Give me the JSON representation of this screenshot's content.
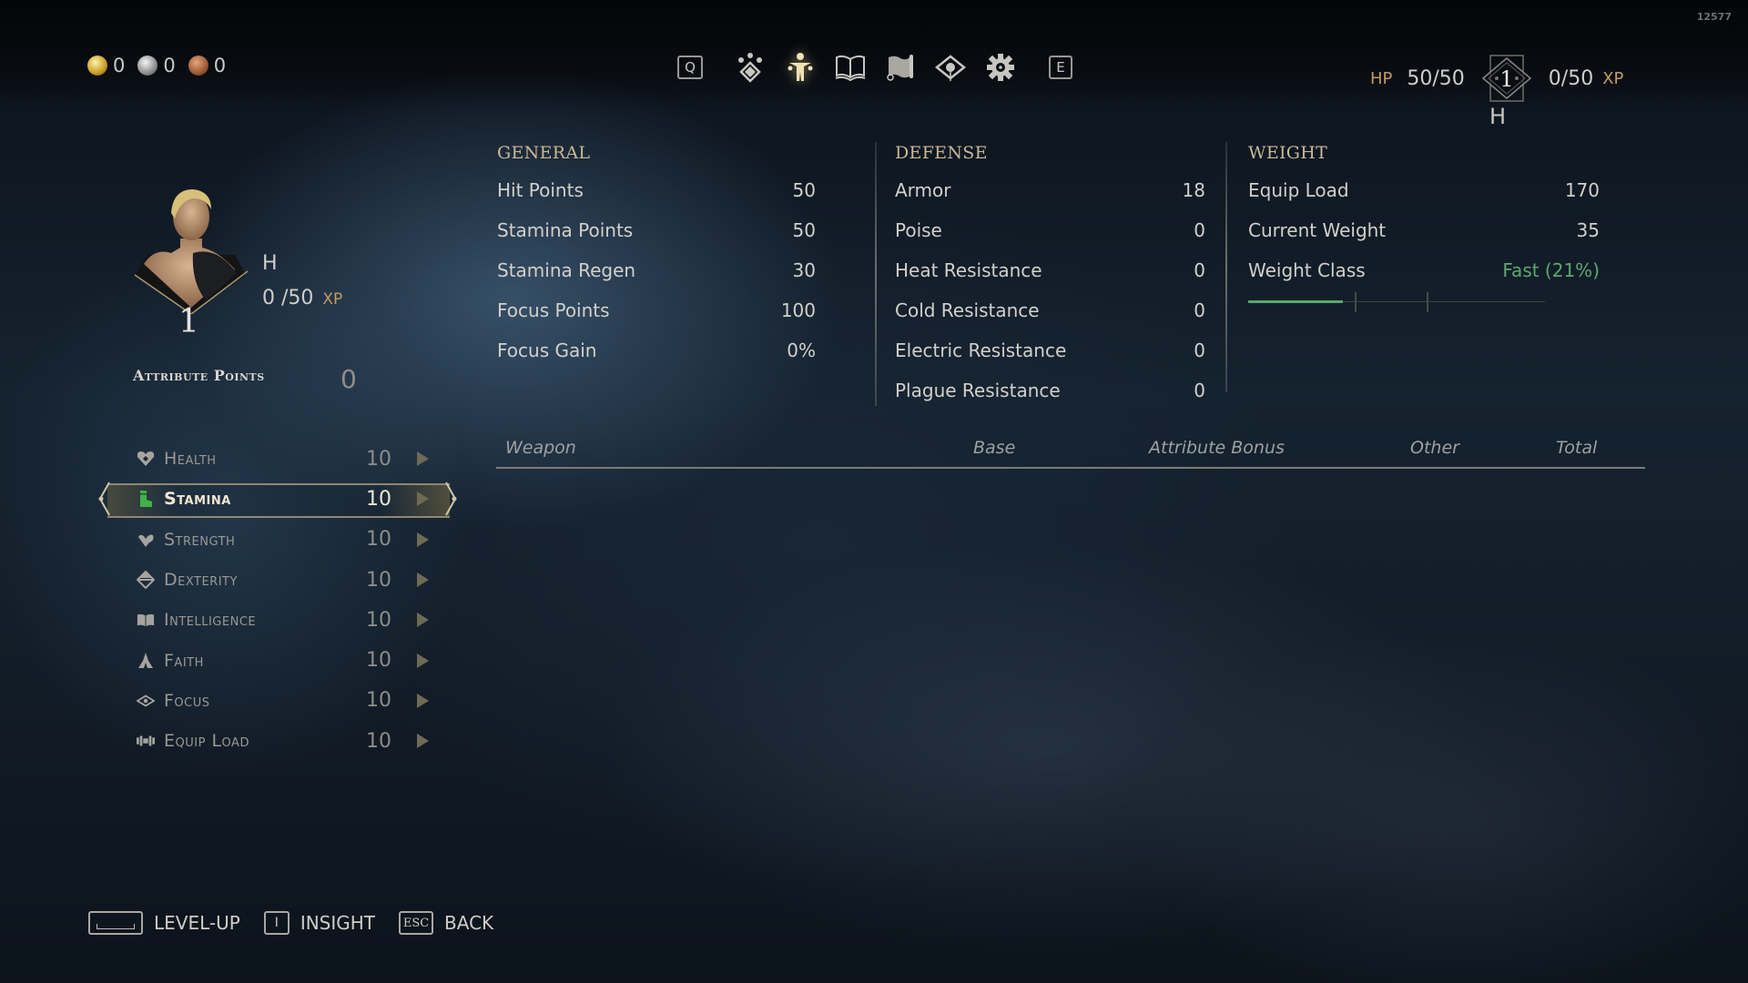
{
  "build_number": "12577",
  "currency": [
    {
      "type": "gold",
      "icon": "gold-coin-icon",
      "amount": "0"
    },
    {
      "type": "silver",
      "icon": "silver-coin-icon",
      "amount": "0"
    },
    {
      "type": "copper",
      "icon": "copper-coin-icon",
      "amount": "0"
    }
  ],
  "top_menu": {
    "prev_key": "Q",
    "next_key": "E",
    "tabs": [
      {
        "icon": "skills-icon",
        "active": false
      },
      {
        "icon": "character-icon",
        "active": true
      },
      {
        "icon": "journal-book-icon",
        "active": false
      },
      {
        "icon": "map-scroll-icon",
        "active": false
      },
      {
        "icon": "eye-insight-icon",
        "active": false
      },
      {
        "icon": "settings-gear-icon",
        "active": false
      }
    ]
  },
  "hud": {
    "hp_label": "HP",
    "hp_value": "50/50",
    "level": "1",
    "xp_value": "0/50",
    "xp_label": "XP",
    "character_initial": "H"
  },
  "character": {
    "name": "H",
    "level": "1",
    "xp_current": "0",
    "xp_max": "50",
    "xp_text": "0 /50",
    "xp_label": "XP",
    "attribute_points_label": "Attribute Points",
    "attribute_points": "0"
  },
  "attributes": [
    {
      "name": "Health",
      "value": "10",
      "icon": "heart-icon",
      "selected": false
    },
    {
      "name": "Stamina",
      "value": "10",
      "icon": "stamina-boot-icon",
      "selected": true
    },
    {
      "name": "Strength",
      "value": "10",
      "icon": "strength-arm-icon",
      "selected": false
    },
    {
      "name": "Dexterity",
      "value": "10",
      "icon": "dexterity-icon",
      "selected": false
    },
    {
      "name": "Intelligence",
      "value": "10",
      "icon": "intelligence-book-icon",
      "selected": false
    },
    {
      "name": "Faith",
      "value": "10",
      "icon": "faith-hands-icon",
      "selected": false
    },
    {
      "name": "Focus",
      "value": "10",
      "icon": "focus-eye-icon",
      "selected": false
    },
    {
      "name": "Equip Load",
      "value": "10",
      "icon": "equip-load-icon",
      "selected": false
    }
  ],
  "general": {
    "title": "GENERAL",
    "rows": [
      {
        "label": "Hit Points",
        "value": "50"
      },
      {
        "label": "Stamina Points",
        "value": "50"
      },
      {
        "label": "Stamina Regen",
        "value": "30"
      },
      {
        "label": "Focus Points",
        "value": "100"
      },
      {
        "label": "Focus Gain",
        "value": "0%"
      }
    ]
  },
  "defense": {
    "title": "DEFENSE",
    "rows": [
      {
        "label": "Armor",
        "value": "18"
      },
      {
        "label": "Poise",
        "value": "0"
      },
      {
        "label": "Heat Resistance",
        "value": "0"
      },
      {
        "label": "Cold Resistance",
        "value": "0"
      },
      {
        "label": "Electric Resistance",
        "value": "0"
      },
      {
        "label": "Plague Resistance",
        "value": "0"
      }
    ]
  },
  "weight": {
    "title": "WEIGHT",
    "rows": [
      {
        "label": "Equip Load",
        "value": "170"
      },
      {
        "label": "Current Weight",
        "value": "35"
      },
      {
        "label": "Weight Class",
        "value": "Fast  (21%)"
      }
    ],
    "class_color": "#5fa86e",
    "load_fraction": 0.21,
    "thresholds": [
      0.36,
      0.6
    ]
  },
  "weapon_table": {
    "columns": [
      "Weapon",
      "Base",
      "Attribute Bonus",
      "Other",
      "Total"
    ],
    "rows": []
  },
  "bottom_actions": [
    {
      "key": "space",
      "label": "LEVEL-UP"
    },
    {
      "key": "I",
      "label": "INSIGHT"
    },
    {
      "key": "ESC",
      "label": "BACK"
    }
  ]
}
